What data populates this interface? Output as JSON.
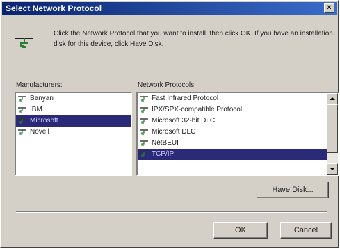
{
  "window": {
    "title": "Select Network Protocol",
    "close_glyph": "×"
  },
  "instruction": "Click the Network Protocol that you want to install, then click OK. If you have an installation disk for this device, click Have Disk.",
  "manufacturers": {
    "label": "Manufacturers:",
    "items": [
      {
        "label": "Banyan",
        "selected": false,
        "icon": "protocol-icon"
      },
      {
        "label": "IBM",
        "selected": false,
        "icon": "protocol-icon"
      },
      {
        "label": "Microsoft",
        "selected": true,
        "icon": "protocol-icon"
      },
      {
        "label": "Novell",
        "selected": false,
        "icon": "protocol-icon"
      }
    ]
  },
  "protocols": {
    "label": "Network Protocols:",
    "items": [
      {
        "label": "Fast Infrared Protocol",
        "selected": false,
        "icon": "protocol-icon"
      },
      {
        "label": "IPX/SPX-compatible Protocol",
        "selected": false,
        "icon": "protocol-icon"
      },
      {
        "label": "Microsoft 32-bit DLC",
        "selected": false,
        "icon": "protocol-icon"
      },
      {
        "label": "Microsoft DLC",
        "selected": false,
        "icon": "protocol-icon"
      },
      {
        "label": "NetBEUI",
        "selected": false,
        "icon": "protocol-icon"
      },
      {
        "label": "TCP/IP",
        "selected": true,
        "icon": "protocol-icon"
      }
    ]
  },
  "buttons": {
    "have_disk": "Have Disk...",
    "ok": "OK",
    "cancel": "Cancel"
  },
  "colors": {
    "title_start": "#0a2470",
    "title_end": "#3a6cc8",
    "selection": "#2a2a78",
    "face": "#d4d0c8"
  }
}
